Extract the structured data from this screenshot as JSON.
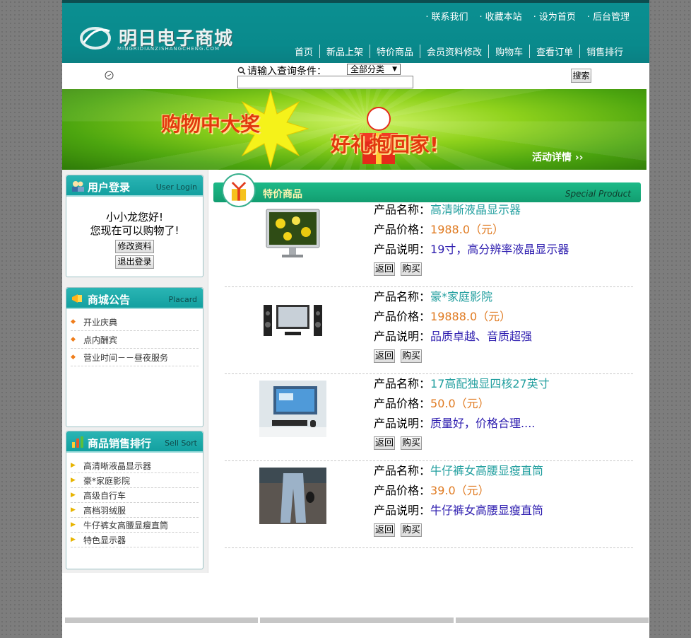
{
  "header": {
    "logo_text": "明日电子商城",
    "logo_sub": "MINGRIDIANZISHANGCHENG.COM",
    "top_links": [
      "联系我们",
      "收藏本站",
      "设为首页",
      "后台管理"
    ],
    "nav": [
      "首页",
      "新品上架",
      "特价商品",
      "会员资料修改",
      "购物车",
      "查看订单",
      "销售排行"
    ]
  },
  "search": {
    "label": "请输入查询条件：",
    "category": "全部分类",
    "input_value": "",
    "button": "搜索"
  },
  "banner": {
    "text_left": "购物中大奖",
    "text_right": "好礼抱回家!",
    "detail": "活动详情 ››"
  },
  "login": {
    "title": "用户登录",
    "subtitle": "User Login",
    "greeting": "小小龙您好!",
    "message": "您现在可以购物了!",
    "edit_button": "修改资料",
    "logout_button": "退出登录"
  },
  "notice": {
    "title": "商城公告",
    "subtitle": "Placard",
    "items": [
      "开业庆典",
      "点内酬宾",
      "营业时间－－昼夜服务"
    ]
  },
  "ranking": {
    "title": "商品销售排行",
    "subtitle": "Sell Sort",
    "items": [
      "高清晰液晶显示器",
      "豪*家庭影院",
      "高级自行车",
      "高档羽绒服",
      "牛仔裤女高腰显瘦直筒",
      "特色显示器"
    ]
  },
  "special": {
    "title": "特价商品",
    "subtitle": "Special Product",
    "labels": {
      "name": "产品名称：",
      "price": "产品价格：",
      "desc": "产品说明：",
      "back": "返回",
      "buy": "购买"
    },
    "products": [
      {
        "name": "高清晰液晶显示器",
        "price": "1988.0（元）",
        "desc": "19寸，高分辨率液晶显示器"
      },
      {
        "name": "豪*家庭影院",
        "price": "19888.0（元）",
        "desc": "品质卓越、音质超强"
      },
      {
        "name": "17高配独显四核27英寸",
        "price": "50.0（元）",
        "desc": "质量好，价格合理...."
      },
      {
        "name": "牛仔裤女高腰显瘦直筒",
        "price": "39.0（元）",
        "desc": "牛仔裤女高腰显瘦直筒"
      }
    ]
  }
}
